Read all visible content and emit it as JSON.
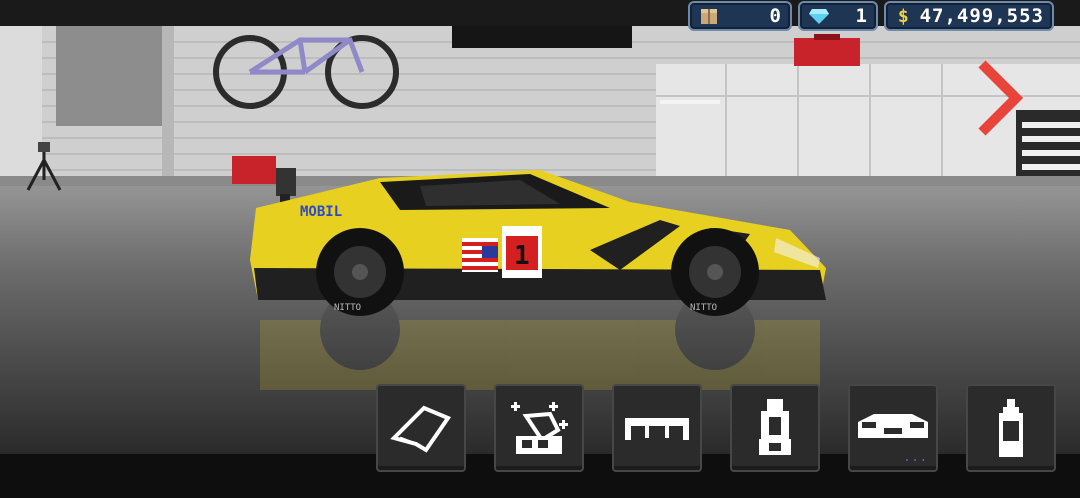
{
  "hud": {
    "parts_count": "0",
    "diamonds_count": "1",
    "money_symbol": "$",
    "money_amount": "47,499,553",
    "parts_icon": "crate-icon",
    "diamonds_icon": "diamond-icon"
  },
  "car": {
    "brand_decal": "MOBIL",
    "race_number": "1",
    "tire_text": "NITTO"
  },
  "toolbar": {
    "tools": [
      {
        "name": "tune-icon"
      },
      {
        "name": "paint-icon"
      },
      {
        "name": "spoiler-icon"
      },
      {
        "name": "seat-icon"
      },
      {
        "name": "body-icon"
      },
      {
        "name": "spray-can-icon"
      }
    ],
    "selected_dots": "..."
  },
  "colors": {
    "car_yellow": "#e8d020",
    "hud_blue": "#1f3554",
    "arrow_red": "#e8443a"
  }
}
